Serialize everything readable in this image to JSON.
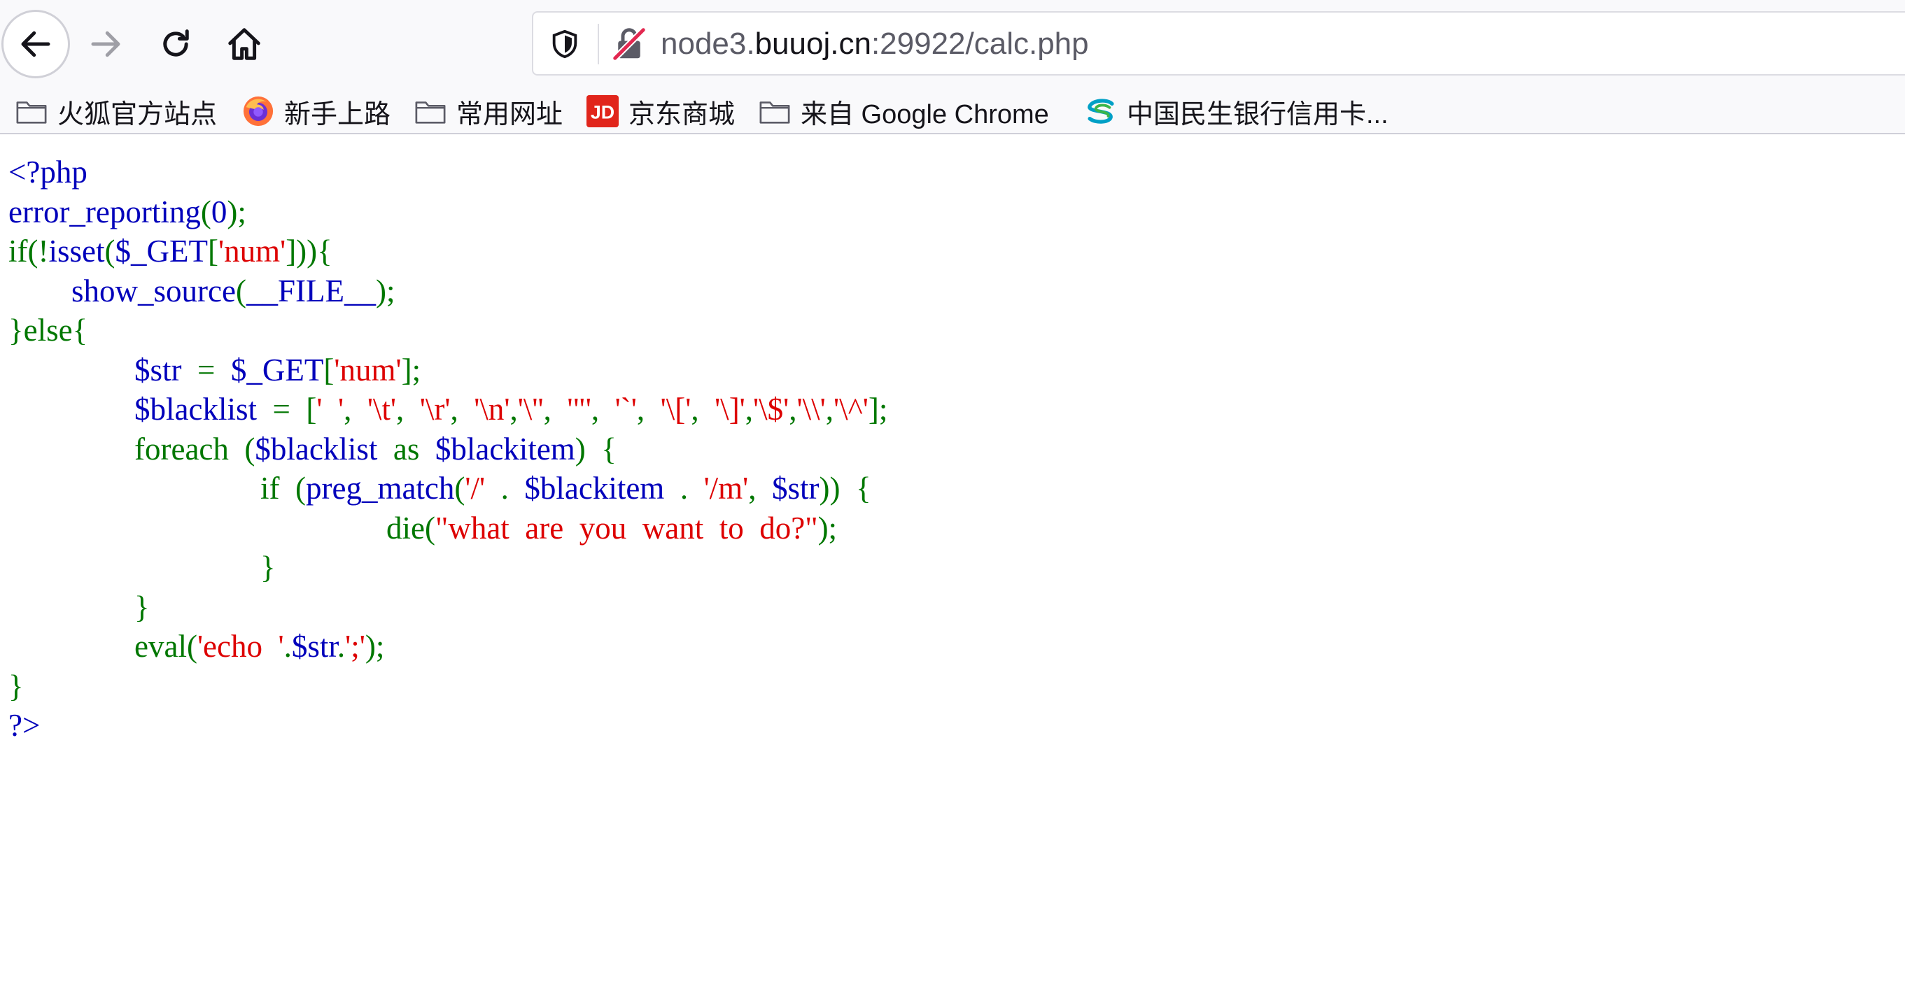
{
  "toolbar": {
    "back_icon": "arrow-left-icon",
    "forward_icon": "arrow-right-icon",
    "reload_icon": "reload-icon",
    "home_icon": "home-icon",
    "url": {
      "prefix": "node3.",
      "domain": "buuoj.cn",
      "suffix": ":29922/calc.php"
    }
  },
  "bookmarks": [
    {
      "icon": "folder-icon",
      "label": "火狐官方站点"
    },
    {
      "icon": "firefox-icon",
      "label": "新手上路"
    },
    {
      "icon": "folder-icon",
      "label": "常用网址"
    },
    {
      "icon": "jd-icon",
      "label": "京东商城"
    },
    {
      "icon": "folder-icon",
      "label": "来自 Google Chrome"
    },
    {
      "icon": "cmbc-icon",
      "label": "中国民生银行信用卡..."
    }
  ],
  "colors": {
    "keyword": "#007700",
    "default": "#0000bb",
    "string": "#dd0000"
  },
  "source_code": [
    [
      [
        "v",
        "<?php"
      ]
    ],
    [
      [
        "v",
        "error_reporting"
      ],
      [
        "k",
        "("
      ],
      [
        "v",
        "0"
      ],
      [
        "k",
        ");"
      ]
    ],
    [
      [
        "k",
        "if(!"
      ],
      [
        "v",
        "isset"
      ],
      [
        "k",
        "("
      ],
      [
        "v",
        "$_GET"
      ],
      [
        "k",
        "["
      ],
      [
        "s",
        "'num'"
      ],
      [
        "k",
        "])){"
      ]
    ],
    [
      [
        "k",
        "        "
      ],
      [
        "v",
        "show_source"
      ],
      [
        "k",
        "("
      ],
      [
        "v",
        "__FILE__"
      ],
      [
        "k",
        ");"
      ]
    ],
    [
      [
        "k",
        "}else{"
      ]
    ],
    [
      [
        "k",
        "                "
      ],
      [
        "v",
        "$str"
      ],
      [
        "k",
        "  =  "
      ],
      [
        "v",
        "$_GET"
      ],
      [
        "k",
        "["
      ],
      [
        "s",
        "'num'"
      ],
      [
        "k",
        "];"
      ]
    ],
    [
      [
        "k",
        "                "
      ],
      [
        "v",
        "$blacklist"
      ],
      [
        "k",
        "  =  ["
      ],
      [
        "s",
        "'  '"
      ],
      [
        "k",
        ",  "
      ],
      [
        "s",
        "'\\t'"
      ],
      [
        "k",
        ",  "
      ],
      [
        "s",
        "'\\r'"
      ],
      [
        "k",
        ",  "
      ],
      [
        "s",
        "'\\n'"
      ],
      [
        "k",
        ","
      ],
      [
        "s",
        "'\\''"
      ],
      [
        "k",
        ",  "
      ],
      [
        "s",
        "'\"'"
      ],
      [
        "k",
        ",  "
      ],
      [
        "s",
        "'`'"
      ],
      [
        "k",
        ",  "
      ],
      [
        "s",
        "'\\['"
      ],
      [
        "k",
        ",  "
      ],
      [
        "s",
        "'\\]'"
      ],
      [
        "k",
        ","
      ],
      [
        "s",
        "'\\$'"
      ],
      [
        "k",
        ","
      ],
      [
        "s",
        "'\\\\'"
      ],
      [
        "k",
        ","
      ],
      [
        "s",
        "'\\^'"
      ],
      [
        "k",
        "];"
      ]
    ],
    [
      [
        "k",
        "                foreach  ("
      ],
      [
        "v",
        "$blacklist"
      ],
      [
        "k",
        "  as  "
      ],
      [
        "v",
        "$blackitem"
      ],
      [
        "k",
        ")  {"
      ]
    ],
    [
      [
        "k",
        "                                if  ("
      ],
      [
        "v",
        "preg_match"
      ],
      [
        "k",
        "("
      ],
      [
        "s",
        "'/'"
      ],
      [
        "k",
        "  .  "
      ],
      [
        "v",
        "$blackitem"
      ],
      [
        "k",
        "  .  "
      ],
      [
        "s",
        "'/m'"
      ],
      [
        "k",
        ",  "
      ],
      [
        "v",
        "$str"
      ],
      [
        "k",
        "))  {"
      ]
    ],
    [
      [
        "k",
        "                                                die("
      ],
      [
        "s",
        "\"what  are  you  want  to  do?\""
      ],
      [
        "k",
        ");"
      ]
    ],
    [
      [
        "k",
        "                                }"
      ]
    ],
    [
      [
        "k",
        "                }"
      ]
    ],
    [
      [
        "k",
        "                eval("
      ],
      [
        "s",
        "'echo  '"
      ],
      [
        "k",
        "."
      ],
      [
        "v",
        "$str"
      ],
      [
        "k",
        "."
      ],
      [
        "s",
        "';'"
      ],
      [
        "k",
        ");"
      ]
    ],
    [
      [
        "k",
        "}"
      ]
    ],
    [
      [
        "v",
        "?>"
      ]
    ]
  ]
}
